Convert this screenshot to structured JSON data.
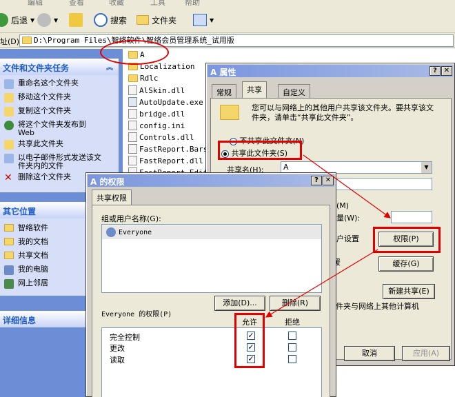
{
  "menubar": {
    "items": [
      "编辑",
      "查看",
      "收藏",
      "工具",
      "帮助"
    ]
  },
  "toolbar": {
    "back": "后退",
    "search": "搜索",
    "folders": "文件夹",
    "address_label": "址(D)"
  },
  "address": {
    "path": "D:\\Program Files\\智络软件\\智络会员管理系统_试用版"
  },
  "leftpane": {
    "tasks_header": "文件和文件夹任务",
    "tasks": [
      "重命名这个文件夹",
      "移动这个文件夹",
      "复制这个文件夹",
      "将这个文件夹发布到 Web",
      "共享此文件夹",
      "以电子邮件形式发送该文件夹内的文件",
      "删除这个文件夹"
    ],
    "places_header": "其它位置",
    "places": [
      "智络软件",
      "我的文档",
      "共享文档",
      "我的电脑",
      "网上邻居"
    ],
    "details_header": "详细信息"
  },
  "files": [
    "A",
    "Localization",
    "Rdlc",
    "AlSkin.dll",
    "AutoUpdate.exe",
    "bridge.dll",
    "config.ini",
    "Controls.dll",
    "FastReport.Bars.",
    "FastReport.dll",
    "FastReport.Edit"
  ],
  "properties_dialog": {
    "title": "A 属性",
    "tabs": [
      "常规",
      "共享",
      "自定义"
    ],
    "description": "您可以与网络上的其他用户共享该文件夹。要共享该文件夹，请单击“共享此文件夹”。",
    "no_share": "不共享此文件夹(N)",
    "share_this": "共享此文件夹(S)",
    "share_name_label": "共享名(H):",
    "share_name_value": "A",
    "limit_label": "户(M)",
    "count_label": "数量(W):",
    "user_settings": "用户设置",
    "permissions_btn": "权限(P)",
    "offline_label": "“缓",
    "cache_btn": "缓存(G)",
    "new_share_btn": "新建共享(E)",
    "firewall_text": "件夹与网络上其他计算机",
    "cancel_btn": "取消",
    "apply_btn": "应用(A)"
  },
  "perm_dialog": {
    "title": "A 的权限",
    "tab": "共享权限",
    "group_label": "组或用户名称(G):",
    "users": [
      "Everyone"
    ],
    "add_btn": "添加(D)...",
    "remove_btn": "删除(R)",
    "perm_label": "Everyone 的权限(P)",
    "allow_header": "允许",
    "deny_header": "拒绝",
    "permissions": [
      {
        "name": "完全控制",
        "allow": "✓",
        "deny": ""
      },
      {
        "name": "更改",
        "allow": "✓",
        "deny": ""
      },
      {
        "name": "读取",
        "allow": "✓",
        "deny": ""
      }
    ]
  }
}
